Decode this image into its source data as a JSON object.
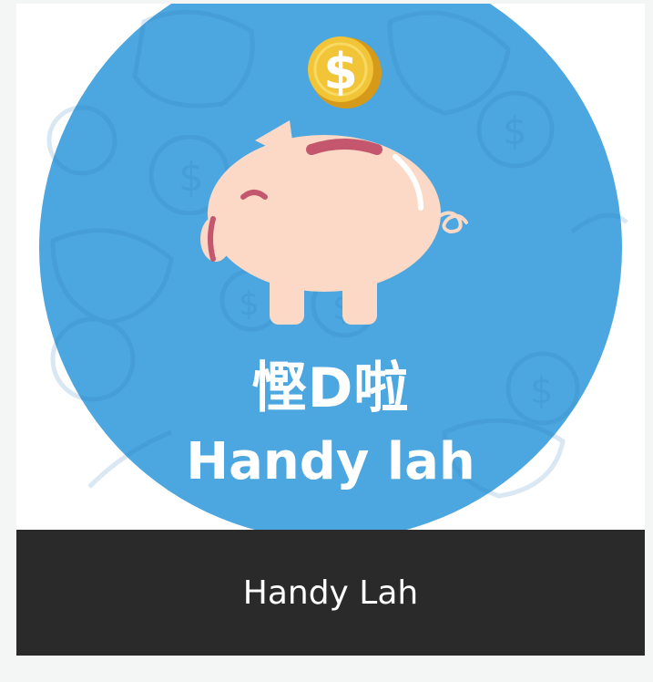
{
  "app": {
    "icon_name": "piggy-bank-coin-icon",
    "logo_title_cn": "慳D啦",
    "logo_title_en": "Handy lah",
    "caption": "Handy Lah"
  },
  "colors": {
    "background": "#f4f5f5",
    "logo_circle": "#4ca6df",
    "pig_body": "#fbd9c6",
    "pig_accent": "#c4576d",
    "coin": "#f2c437",
    "coin_dark": "#d69a1b",
    "caption_bar": "#2a2a2a",
    "caption_text": "#ffffff"
  }
}
